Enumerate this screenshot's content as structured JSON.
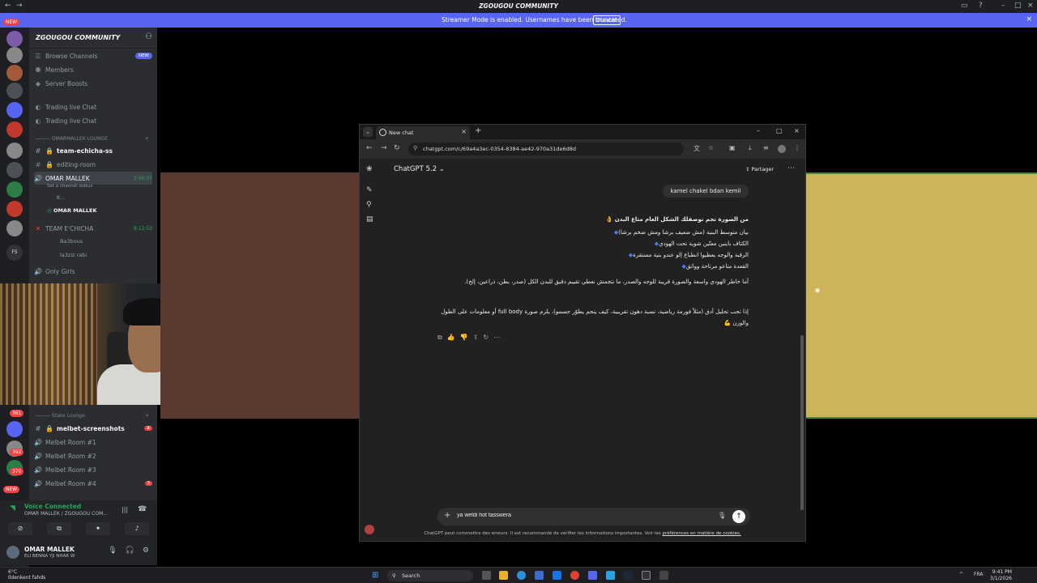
{
  "discord": {
    "window_title": "ZGOUGOU COMMUNITY",
    "streamer_bar": {
      "message": "Streamer Mode is enabled. Usernames have been truncated.",
      "disable_label": "Disable"
    },
    "rail_badges": [
      "NEW",
      "2",
      "3",
      "1",
      "2",
      "1",
      "2",
      "1",
      "2",
      "1",
      "2",
      "361",
      "392",
      "370",
      "NEW"
    ],
    "guild_name": "ZGOUGOU COMMUNITY",
    "channels": {
      "browse": "Browse Channels",
      "browse_badge": "NEW",
      "members": "Members",
      "boosts": "Server Boosts",
      "trading1": "Trading live Chat",
      "trading2": "Trading live Chat",
      "cat_lounge": "OMARMALLEK LOUNGE",
      "team_echicha": "team-echicha-ss",
      "editing_room": "editing-room",
      "omar_mallek": "OMAR MALLEK",
      "omar_time": "2:56:37",
      "channel_status": "Set a channel status",
      "k_user": "K...",
      "omar_stream_user": "OMAR MALLEK",
      "team_echicha_voice": "TEAM E'CHICHA",
      "team_time": "8:12:53",
      "user1": "Ba3bous",
      "user2": "la3ziz rabi",
      "only_girls": "Only Girls",
      "cat_stake": "Stake Lounge",
      "melbet_screens": "melbet-screenshots",
      "melbet_screens_count": "2",
      "melbet1": "Melbet Room #1",
      "melbet2": "Melbet Room #2",
      "melbet3": "Melbet Room #3",
      "melbet4": "Melbet Room #4",
      "melbet4_count": "3"
    },
    "voice": {
      "status": "Voice Connected",
      "channel": "OMAR MALLEK / ZGOUGOU COM..."
    },
    "user": {
      "name": "OMAR MALLEK",
      "status": "ELI BENNA YJI NHAR W"
    }
  },
  "browser": {
    "tab_title": "New chat",
    "url": "chatgpt.com/c/69a4a3ec-0354-8384-ae42-970a31de6d8d",
    "model": "ChatGPT 5.2",
    "share_label": "Partager",
    "user_message": "kamel chakel bdan kemil",
    "reply": {
      "intro": "من الصورة نجم نوصفلك الشكل العام متاع البدن 👌",
      "bullets": [
        "بيان متوسط البنية (مش ضعيف برشا ومش ضخم برشا)",
        "الكتاف باينين معتّين شوية تحت الهودي",
        "الرقبة والوجه يعطيوا انطباع إلو عندو بنية مستقرة",
        "القعدة متاعو مرتاحة وواثق"
      ],
      "para1": "أما خاطر الهودي واسعة والصورة قريبة للوجه والصدر، ما نتجمش نعطي تقييم دقيق للبدن الكل (صدر، بطن، ذراعين، إلخ).",
      "para2": "إذا تحب تحليل أدق (مثلاً فورمة رياضية، نسبة دهون تقريبية، كيف ينجم يطوّر جسمو)، يلزم صورة full body أو معلومات على الطول والوزن 💪"
    },
    "composer_value": "ya weldi hot tasswera",
    "disclaimer": "ChatGPT peut commettre des erreurs. Il est recommandé de vérifier les informations importantes. Voir les",
    "disclaimer_link": "préférences en matière de cookies."
  },
  "taskbar": {
    "weather_temp": "6°C",
    "weather_desc": "Ildenkent fahds",
    "search_label": "Search",
    "lang": "FRA",
    "time": "9:41 PM",
    "date": "3/1/2026"
  },
  "colors": {
    "discord_blurple": "#5865f2",
    "voice_green": "#23a559",
    "badge_red": "#f23f43"
  }
}
